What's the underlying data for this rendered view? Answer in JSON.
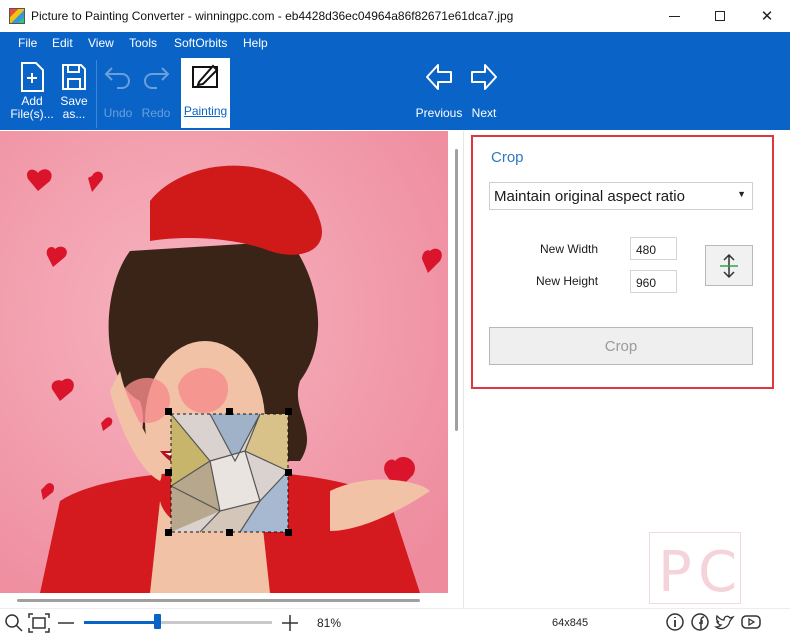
{
  "window": {
    "title": "Picture to Painting Converter - winningpc.com - eb4428d36ec04964a86f82671e61dca7.jpg",
    "minimize_icon": "minimize-icon",
    "maximize_icon": "maximize-icon",
    "close_glyph": "✕"
  },
  "menu": {
    "items": [
      "File",
      "Edit",
      "View",
      "Tools",
      "SoftOrbits",
      "Help"
    ]
  },
  "toolbar": {
    "add_files_line1": "Add",
    "add_files_line2": "File(s)...",
    "save_line1": "Save",
    "save_line2": "as...",
    "undo": "Undo",
    "redo": "Redo",
    "painting": "Painting",
    "previous": "Previous",
    "next": "Next"
  },
  "crop": {
    "title": "Crop",
    "aspect_option": "Maintain original aspect ratio",
    "width_label": "New Width",
    "width_value": "480",
    "height_label": "New Height",
    "height_value": "960",
    "crop_button": "Crop"
  },
  "status": {
    "zoom": "81%",
    "dimensions": "64x845",
    "zoom_slider_fraction": 0.39
  },
  "colors": {
    "accent": "#0a64c8",
    "highlight_border": "#e0363f",
    "photo_bg": "#f39aa9"
  }
}
